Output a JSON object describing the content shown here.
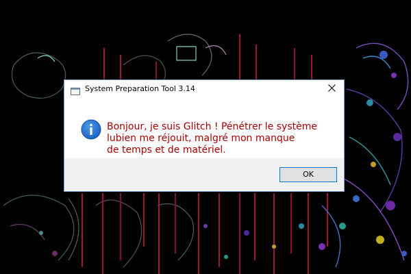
{
  "dialog": {
    "title": "System Preparation Tool 3.14",
    "icon": "info-icon",
    "message_lines": [
      "Bonjour, je suis Glitch ! Pénétrer le système",
      "lubien me réjouit, malgré mon manque",
      "de temps et de matériel."
    ],
    "ok_label": "OK"
  },
  "colors": {
    "message_text": "#aa0000",
    "info_icon": "#1e6fd1",
    "background": "#000000",
    "footer": "#f0f0f0",
    "button_border": "#0078d7"
  }
}
